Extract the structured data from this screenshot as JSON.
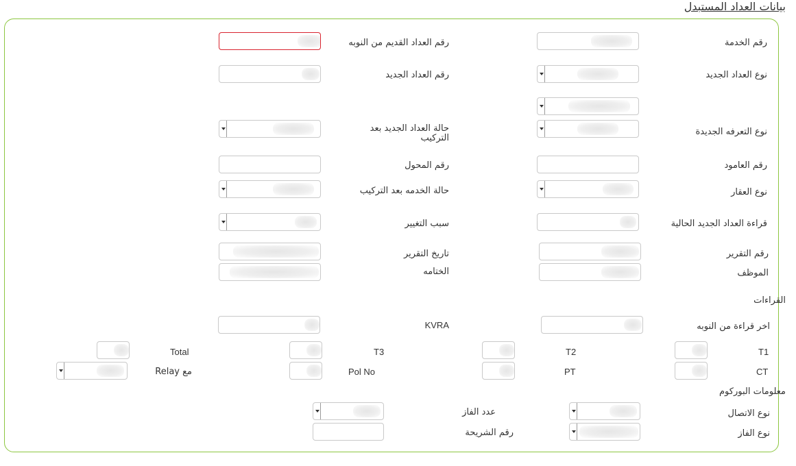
{
  "section_title": "بيانات العداد المستبدل",
  "labels": {
    "service_no": "رقم الخدمة",
    "old_meter_no": "رقم العداد القديم من النوبه",
    "new_meter_type": "نوع العداد الجديد",
    "new_meter_no": "رقم العداد الجديد",
    "new_tariff_type": "نوع التعرفه الجديدة",
    "meter_status_after": "حالة العداد  الجديد بعد التركيب",
    "pole_no": "رقم العامود",
    "transformer_no": "رقم المحول",
    "property_type": "نوع العقار",
    "service_status_after": "حالة الخدمه بعد التركيب",
    "current_reading": "قراءة العداد الجديد الحالية",
    "change_reason": "سبب التغيير",
    "report_no": "رقم التقرير",
    "report_date": "تاريخ التقرير",
    "employee": "الموظف",
    "seal": "الختامه",
    "readings_heading": "القراءات",
    "last_reading": "اخر قراءة من النوبه",
    "kvra": "KVRA",
    "t1": "T1",
    "t2": "T2",
    "t3": "T3",
    "total": "Total",
    "ct": "CT",
    "pt": "PT",
    "pol_no": "Pol No",
    "with_relay": "مع Relay",
    "bourcom_heading": "معلومات البوركوم",
    "connection_type": "نوع الاتصال",
    "phase_count": "عدد الفاز",
    "phase_type": "نوع الفاز",
    "chip_no": "رقم الشريحة"
  }
}
